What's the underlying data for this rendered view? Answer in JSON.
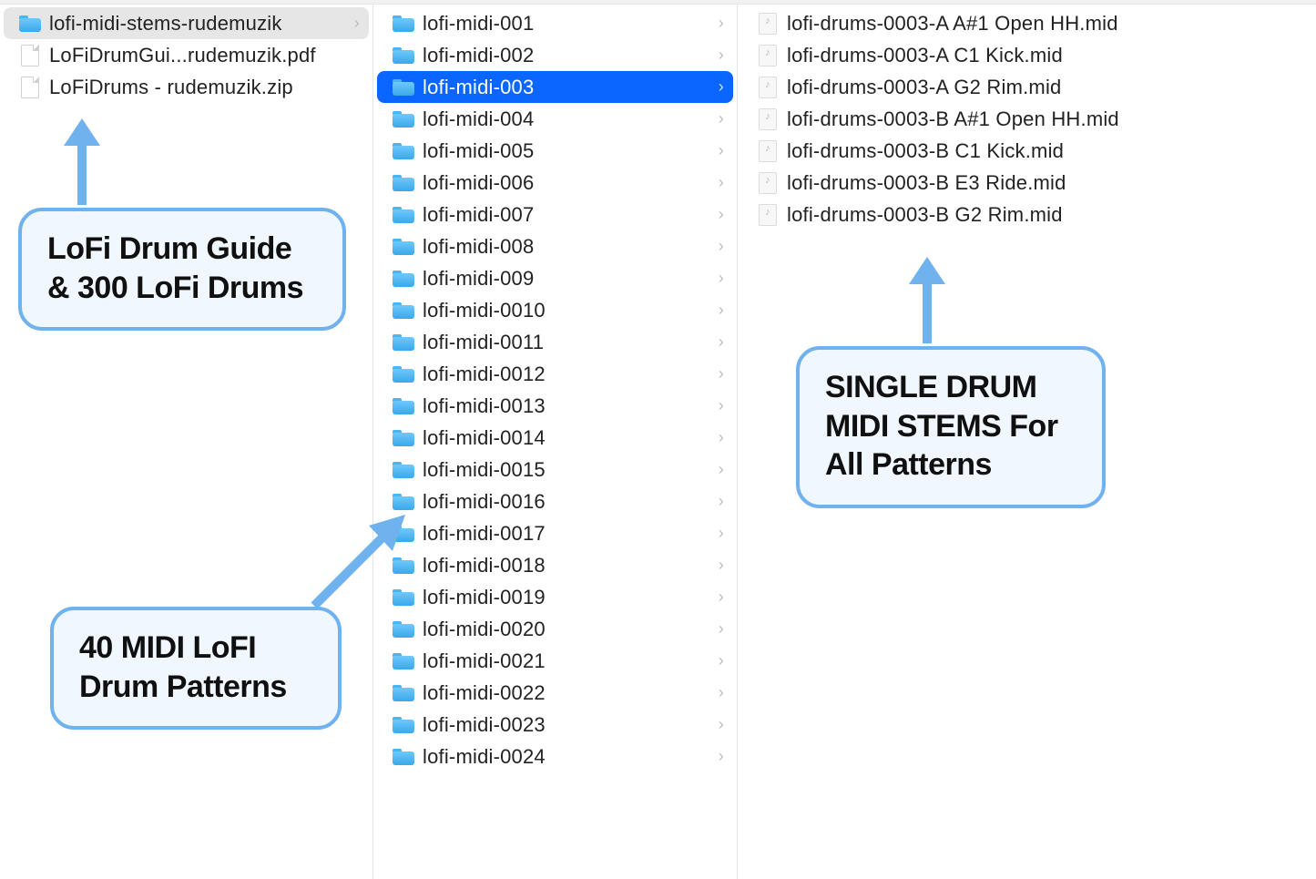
{
  "columns": {
    "col1": {
      "items": [
        {
          "icon": "folder",
          "name": "lofi-midi-stems-rudemuzik",
          "chev": true,
          "selected_style": "grey"
        },
        {
          "icon": "doc",
          "name": "LoFiDrumGui...rudemuzik.pdf"
        },
        {
          "icon": "doc",
          "name": "LoFiDrums - rudemuzik.zip"
        }
      ]
    },
    "col2": {
      "items": [
        {
          "icon": "folder",
          "name": "lofi-midi-001",
          "chev": true
        },
        {
          "icon": "folder",
          "name": "lofi-midi-002",
          "chev": true
        },
        {
          "icon": "folder",
          "name": "lofi-midi-003",
          "chev": true,
          "selected_style": "blue"
        },
        {
          "icon": "folder",
          "name": "lofi-midi-004",
          "chev": true
        },
        {
          "icon": "folder",
          "name": "lofi-midi-005",
          "chev": true
        },
        {
          "icon": "folder",
          "name": "lofi-midi-006",
          "chev": true
        },
        {
          "icon": "folder",
          "name": "lofi-midi-007",
          "chev": true
        },
        {
          "icon": "folder",
          "name": "lofi-midi-008",
          "chev": true
        },
        {
          "icon": "folder",
          "name": "lofi-midi-009",
          "chev": true
        },
        {
          "icon": "folder",
          "name": "lofi-midi-0010",
          "chev": true
        },
        {
          "icon": "folder",
          "name": "lofi-midi-0011",
          "chev": true
        },
        {
          "icon": "folder",
          "name": "lofi-midi-0012",
          "chev": true
        },
        {
          "icon": "folder",
          "name": "lofi-midi-0013",
          "chev": true
        },
        {
          "icon": "folder",
          "name": "lofi-midi-0014",
          "chev": true
        },
        {
          "icon": "folder",
          "name": "lofi-midi-0015",
          "chev": true
        },
        {
          "icon": "folder",
          "name": "lofi-midi-0016",
          "chev": true
        },
        {
          "icon": "folder",
          "name": "lofi-midi-0017",
          "chev": true
        },
        {
          "icon": "folder",
          "name": "lofi-midi-0018",
          "chev": true
        },
        {
          "icon": "folder",
          "name": "lofi-midi-0019",
          "chev": true
        },
        {
          "icon": "folder",
          "name": "lofi-midi-0020",
          "chev": true
        },
        {
          "icon": "folder",
          "name": "lofi-midi-0021",
          "chev": true
        },
        {
          "icon": "folder",
          "name": "lofi-midi-0022",
          "chev": true
        },
        {
          "icon": "folder",
          "name": "lofi-midi-0023",
          "chev": true
        },
        {
          "icon": "folder",
          "name": "lofi-midi-0024",
          "chev": true
        }
      ]
    },
    "col3": {
      "items": [
        {
          "icon": "midi",
          "name": "lofi-drums-0003-A A#1 Open HH.mid"
        },
        {
          "icon": "midi",
          "name": "lofi-drums-0003-A C1 Kick.mid"
        },
        {
          "icon": "midi",
          "name": "lofi-drums-0003-A G2 Rim.mid"
        },
        {
          "icon": "midi",
          "name": "lofi-drums-0003-B A#1 Open HH.mid"
        },
        {
          "icon": "midi",
          "name": "lofi-drums-0003-B C1 Kick.mid"
        },
        {
          "icon": "midi",
          "name": "lofi-drums-0003-B E3 Ride.mid"
        },
        {
          "icon": "midi",
          "name": "lofi-drums-0003-B G2 Rim.mid"
        }
      ]
    }
  },
  "callouts": {
    "c1": "LoFi Drum Guide & 300 LoFi Drums",
    "c2": "40 MIDI LoFI Drum Patterns",
    "c3": "SINGLE DRUM MIDI STEMS For All Patterns"
  },
  "colors": {
    "selection_blue": "#0a66ff",
    "folder_blue": "#49b6f2",
    "callout_border": "#6fb2ee",
    "callout_fill": "#f0f7fe"
  }
}
